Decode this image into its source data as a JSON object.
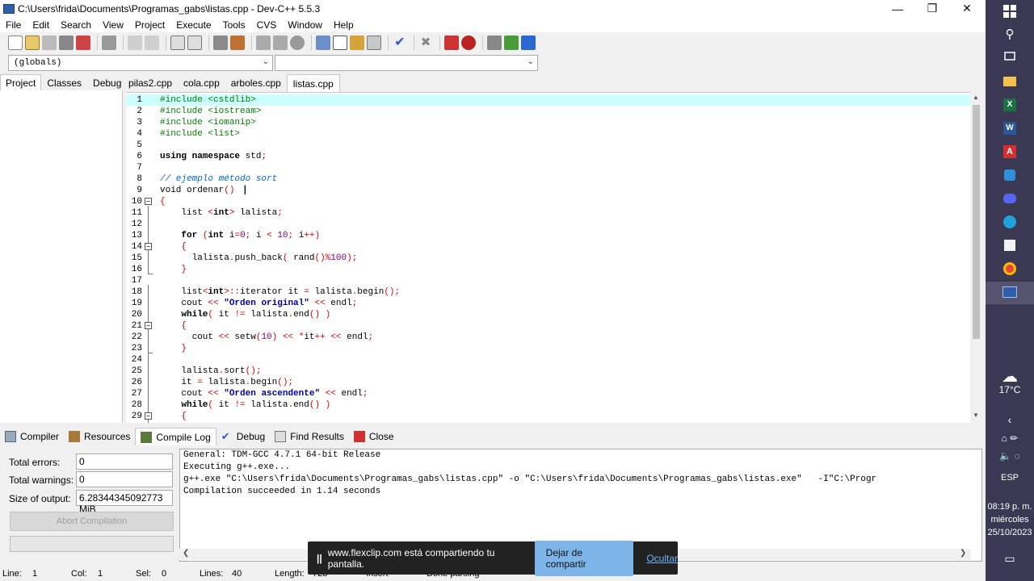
{
  "window": {
    "title": "C:\\Users\\frida\\Documents\\Programas_gabs\\listas.cpp - Dev-C++ 5.5.3",
    "minimize": "—",
    "restore": "❐",
    "close": "✕"
  },
  "menu": [
    "File",
    "Edit",
    "Search",
    "View",
    "Project",
    "Execute",
    "Tools",
    "CVS",
    "Window",
    "Help"
  ],
  "combos": {
    "scope": "(globals)",
    "member": ""
  },
  "left_tabs": [
    "Project",
    "Classes",
    "Debug"
  ],
  "file_tabs": [
    "pilas2.cpp",
    "cola.cpp",
    "arboles.cpp",
    "listas.cpp"
  ],
  "code_lines": [
    "1",
    "2",
    "3",
    "4",
    "5",
    "6",
    "7",
    "8",
    "9",
    "10",
    "11",
    "12",
    "13",
    "14",
    "15",
    "16",
    "17",
    "18",
    "19",
    "20",
    "21",
    "22",
    "23",
    "24",
    "25",
    "26",
    "27",
    "28",
    "29"
  ],
  "code": {
    "l1": "#include <cstdlib>",
    "l2": "#include <iostream>",
    "l3": "#include <iomanip>",
    "l4": "#include <list>",
    "l6_kw": "using namespace",
    "l6_rest": " std",
    "l8": "// ejemplo método sort",
    "l9_kw": "void",
    "l9_rest": " ordenar",
    "l11_a": "    list ",
    "l11_kw": "int",
    "l11_b": " lalista",
    "l13_kw": "for",
    "l13_kw2": "int",
    "l13_i": " i",
    "l13_n0": "0",
    "l13_n10": "10",
    "l15_a": "      lalista",
    "l15_b": "push_back",
    "l15_c": " rand",
    "l15_n": "100",
    "l18_a": "    list",
    "l18_kw": "int",
    "l18_b": "iterator it ",
    "l18_c": " lalista",
    "l18_d": "begin",
    "l19_a": "    cout ",
    "l19_s": "\"Orden original\"",
    "l19_b": " endl",
    "l20_kw": "while",
    "l20_a": " it ",
    "l20_b": " lalista",
    "l20_c": "end",
    "l22_a": "      cout ",
    "l22_b": " setw",
    "l22_n": "10",
    "l22_c": "it",
    "l22_d": " endl",
    "l25_a": "    lalista",
    "l25_b": "sort",
    "l26_a": "    it ",
    "l26_b": " lalista",
    "l26_c": "begin",
    "l27_a": "    cout ",
    "l27_s": "\"Orden ascendente\"",
    "l27_b": " endl",
    "l28_kw": "while",
    "l28_a": " it ",
    "l28_b": " lalista",
    "l28_c": "end"
  },
  "bottom_tabs": [
    "Compiler",
    "Resources",
    "Compile Log",
    "Debug",
    "Find Results",
    "Close"
  ],
  "stats": {
    "errors_label": "Total errors:",
    "errors_value": "0",
    "warnings_label": "Total warnings:",
    "warnings_value": "0",
    "size_label": "Size of output:",
    "size_value": "6.28344345092773 MiB",
    "abort": "Abort Compilation"
  },
  "log": [
    "General: TDM-GCC 4.7.1 64-bit Release",
    "Executing g++.exe...",
    "g++.exe \"C:\\Users\\frida\\Documents\\Programas_gabs\\listas.cpp\" -o \"C:\\Users\\frida\\Documents\\Programas_gabs\\listas.exe\"   -I\"C:\\Progr",
    "Compilation succeeded in 1.14 seconds"
  ],
  "status": {
    "line_label": "Line:",
    "line_value": "1",
    "col_label": "Col:",
    "col_value": "1",
    "sel_label": "Sel:",
    "sel_value": "0",
    "lines_label": "Lines:",
    "lines_value": "40",
    "length_label": "Length:",
    "length_value": "723",
    "mode": "Insert",
    "parse": "Done parsing"
  },
  "share_bar": {
    "message": "www.flexclip.com está compartiendo tu pantalla.",
    "stop": "Dejar de compartir",
    "hide": "Ocultar"
  },
  "tray": {
    "temp": "17°C",
    "lang": "ESP",
    "time": "08:19 p. m.",
    "day": "miércoles",
    "date": "25/10/2023"
  }
}
